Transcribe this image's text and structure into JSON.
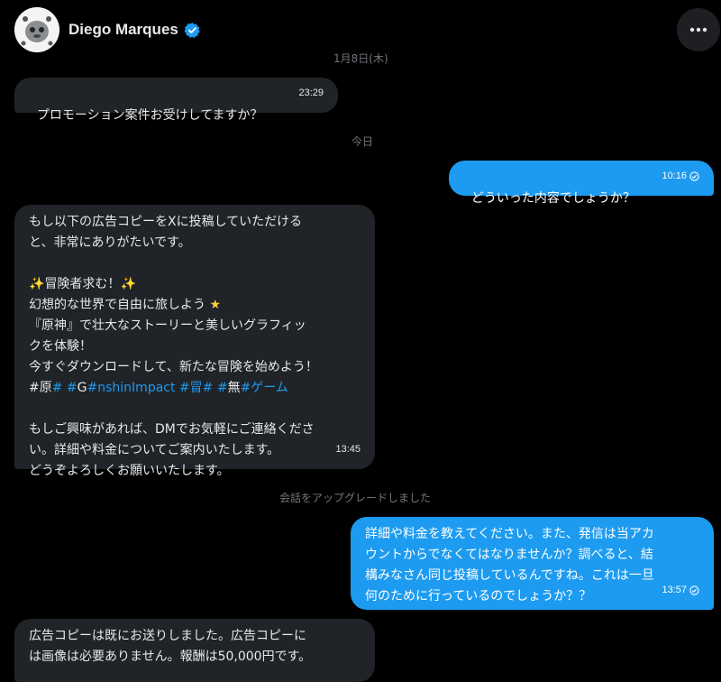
{
  "header": {
    "name": "Diego Marques",
    "verified_icon": "verified-badge-icon",
    "more_icon": "more-horizontal-icon"
  },
  "dates": {
    "first": "1月8日(木)",
    "today": "今日"
  },
  "messages": [
    {
      "direction": "in",
      "text": "プロモーション案件お受けしてますか？",
      "time": "23:29"
    },
    {
      "direction": "out",
      "text": "どういった内容でしょうか？",
      "time": "10:16"
    },
    {
      "direction": "in",
      "lines": {
        "l1": "もし以下の広告コピーをXに投稿していただける",
        "l2": "と、非常にありがたいです。",
        "l3": "冒険者求む！",
        "l4": "幻想的な世界で自由に旅しよう",
        "l5": "『原神』で壮大なストーリーと美しいグラフィッ",
        "l6": "クを体験！",
        "l7": "今すぐダウンロードして、新たな冒険を始めよう！",
        "h1": "#原",
        "h2": "#",
        "h3": " #",
        "h4": "G",
        "h5": "#nshinImpact",
        "h6": " #冒",
        "h7": "# #",
        "h8": "無",
        "h9": "#ゲーム",
        "l9": "もしご興味があれば、DMでお気軽にご連絡くださ",
        "l10": "い。詳細や料金についてご案内いたします。",
        "l11": "どうぞよろしくお願いいたします。"
      },
      "time": "13:45"
    },
    {
      "direction": "out",
      "lines": {
        "l1": "詳細や料金を教えてください。また、発信は当アカ",
        "l2": "ウントからでなくてはなりませんか？調べると、結",
        "l3": "構みなさん同じ投稿しているんですね。これは一旦",
        "l4": "何のために行っているのでしょうか？？"
      },
      "time": "13:57"
    },
    {
      "direction": "in",
      "lines": {
        "l1": "広告コピーは既にお送りしました。広告コピーに",
        "l2": "は画像は必要ありません。報酬は50,000円です。"
      }
    }
  ],
  "system": {
    "upgrade": "会話をアップグレードしました"
  },
  "colors": {
    "background": "#000000",
    "incoming_bubble": "#202327",
    "outgoing_bubble": "#1d9bf0",
    "link": "#1d9bf0",
    "muted": "#71767b"
  },
  "emoji": {
    "sparkles": "sparkles-icon",
    "star": "star-icon",
    "sent_check": "sent-check-icon"
  }
}
